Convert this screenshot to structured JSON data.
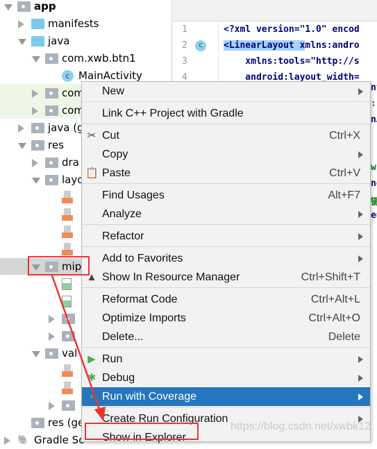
{
  "tree": {
    "items": [
      {
        "label": "app",
        "state": "expanded",
        "icon": "module-folder-icon"
      },
      {
        "label": "manifests",
        "state": "collapsed",
        "icon": "folder-icon"
      },
      {
        "label": "java",
        "state": "expanded",
        "icon": "folder-icon"
      },
      {
        "label": "com.xwb.btn1",
        "state": "expanded",
        "icon": "package-icon"
      },
      {
        "label": "MainActivity",
        "icon": "class-icon"
      },
      {
        "label": "com",
        "state": "collapsed",
        "icon": "package-icon"
      },
      {
        "label": "com",
        "state": "collapsed",
        "icon": "package-icon"
      },
      {
        "label": "java (g",
        "state": "collapsed",
        "icon": "generated-folder-icon"
      },
      {
        "label": "res",
        "state": "expanded",
        "icon": "res-folder-icon"
      },
      {
        "label": "dra",
        "state": "collapsed",
        "icon": "folder-icon"
      },
      {
        "label": "layo",
        "state": "expanded",
        "icon": "folder-icon"
      },
      {
        "label": "",
        "icon": "xml-file-icon"
      },
      {
        "label": "",
        "icon": "xml-file-icon"
      },
      {
        "label": "",
        "icon": "xml-file-icon"
      },
      {
        "label": "",
        "icon": "xml-file-icon"
      },
      {
        "label": "mip",
        "state": "expanded",
        "icon": "folder-icon"
      },
      {
        "label": "",
        "icon": "image-file-icon"
      },
      {
        "label": "",
        "icon": "image-file-icon"
      },
      {
        "label": "",
        "state": "collapsed",
        "icon": "folder-icon"
      },
      {
        "label": "",
        "state": "collapsed",
        "icon": "folder-icon"
      },
      {
        "label": "val",
        "state": "expanded",
        "icon": "folder-icon"
      },
      {
        "label": "",
        "icon": "xml-file-icon"
      },
      {
        "label": "",
        "icon": "xml-file-icon"
      },
      {
        "label": "",
        "state": "collapsed",
        "icon": "folder-icon"
      },
      {
        "label": "res (ge",
        "icon": "res-folder-icon"
      },
      {
        "label": "Gradle Sc",
        "state": "collapsed",
        "icon": "gradle-icon"
      }
    ]
  },
  "editor": {
    "line_numbers": [
      "1",
      "2",
      "3",
      "4"
    ],
    "lines": [
      "<?xml version=\"1.0\" encod",
      "<LinearLayout xmlns:andro",
      "    xmlns:tools=\"http://s",
      "    android:layout_width="
    ],
    "fragments": [
      "nt",
      ":'",
      "nA",
      "w:",
      "ne",
      "键",
      "e="
    ]
  },
  "menu": {
    "items": [
      {
        "label": "New",
        "submenu": true
      },
      {
        "sep": true
      },
      {
        "label": "Link C++ Project with Gradle"
      },
      {
        "sep": true
      },
      {
        "label": "Cut",
        "shortcut": "Ctrl+X",
        "icon": "scissors-icon"
      },
      {
        "label": "Copy",
        "submenu": true
      },
      {
        "label": "Paste",
        "shortcut": "Ctrl+V",
        "icon": "clipboard-icon"
      },
      {
        "sep": true
      },
      {
        "label": "Find Usages",
        "shortcut": "Alt+F7"
      },
      {
        "label": "Analyze",
        "submenu": true
      },
      {
        "sep": true
      },
      {
        "label": "Refactor",
        "submenu": true
      },
      {
        "sep": true
      },
      {
        "label": "Add to Favorites",
        "submenu": true
      },
      {
        "label": "Show In Resource Manager",
        "shortcut": "Ctrl+Shift+T",
        "icon": "resource-manager-icon"
      },
      {
        "sep": true
      },
      {
        "label": "Reformat Code",
        "shortcut": "Ctrl+Alt+L"
      },
      {
        "label": "Optimize Imports",
        "shortcut": "Ctrl+Alt+O"
      },
      {
        "label": "Delete...",
        "shortcut": "Delete"
      },
      {
        "sep": true
      },
      {
        "label": "Run",
        "submenu": true,
        "icon": "run-icon"
      },
      {
        "label": "Debug",
        "submenu": true,
        "icon": "debug-icon"
      },
      {
        "label": "Run with Coverage",
        "submenu": true,
        "active": true,
        "icon": "coverage-icon"
      },
      {
        "sep": true
      },
      {
        "label": "Create Run Configuration",
        "submenu": true
      },
      {
        "label": "Show in Explorer"
      }
    ]
  },
  "colors": {
    "accent": "#2675bf",
    "annotation": "#ee3333"
  },
  "watermark": "https://blog.csdn.net/xwbk12"
}
